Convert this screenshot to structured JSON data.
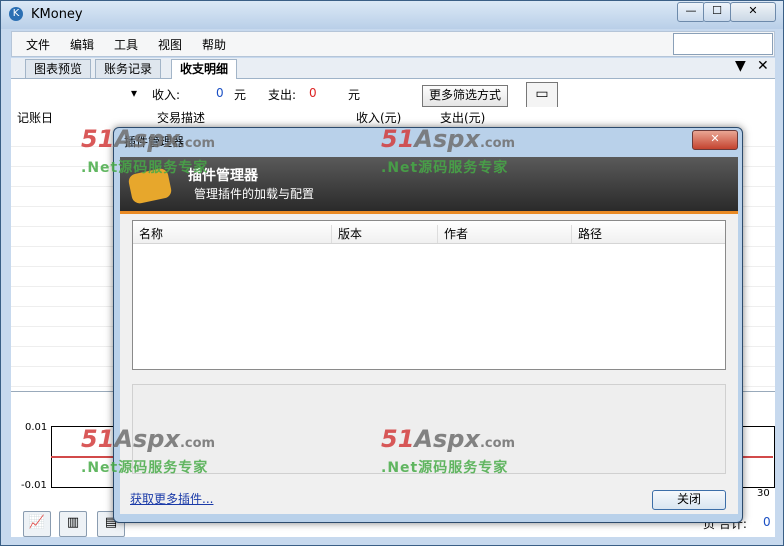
{
  "window": {
    "title": "KMoney",
    "minimize_glyph": "—",
    "maximize_glyph": "☐",
    "close_glyph": "✕"
  },
  "menu": [
    "文件",
    "编辑",
    "工具",
    "视图",
    "帮助"
  ],
  "tabs": [
    {
      "label": "图表预览",
      "active": false
    },
    {
      "label": "账务记录",
      "active": false
    },
    {
      "label": "收支明细",
      "active": true
    }
  ],
  "tab_controls": {
    "dropdown": "▼",
    "close": "✕"
  },
  "filters": {
    "dropdown_arrow": "▾",
    "income_label": "收入:",
    "income_value": "0",
    "income_unit": "元",
    "expense_label": "支出:",
    "expense_value": "0",
    "expense_unit": "元",
    "more_filter_button": "更多筛选方式",
    "print_icon": "printer-icon"
  },
  "grid_columns": [
    "记账日",
    "交易描述",
    "收入(元)",
    "支出(元)"
  ],
  "chart": {
    "y_top": "0.01",
    "y_bottom": "-0.01",
    "x_end": "30",
    "line_color": "#d24a4a"
  },
  "bottom": {
    "buttons": [
      "chart-icon",
      "books-icon",
      "report-icon"
    ],
    "total_label": "页 合计:",
    "total_value": "0"
  },
  "dialog": {
    "title": "插件管理器",
    "close_glyph": "✕",
    "heading": "插件管理器",
    "subheading": "管理插件的加载与配置",
    "columns": [
      "名称",
      "版本",
      "作者",
      "路径"
    ],
    "more_link": "获取更多插件...",
    "close_button": "关闭"
  },
  "watermark": {
    "logo_main": "51",
    "logo_mid": "Aspx",
    "logo_tail": ".com",
    "slogan": ".Net源码服务专家"
  }
}
